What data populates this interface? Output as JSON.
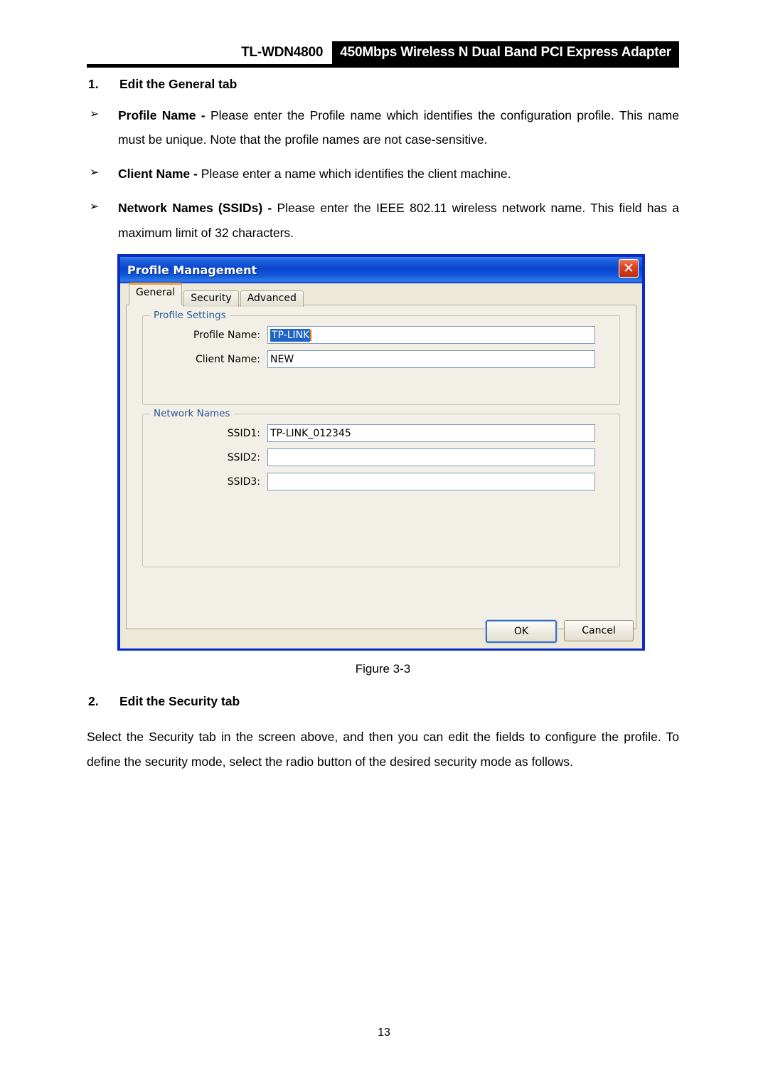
{
  "header": {
    "model": "TL-WDN4800",
    "product": "450Mbps Wireless N Dual Band PCI Express Adapter"
  },
  "sections": [
    {
      "number": "1.",
      "title": "Edit the General tab"
    },
    {
      "number": "2.",
      "title": "Edit the Security tab"
    }
  ],
  "bullets": [
    {
      "marker": "➢",
      "term": "Profile Name",
      "dash": " - ",
      "description": "Please enter the Profile name which identifies the configuration profile. This name must be unique. Note that the profile names are not case-sensitive."
    },
    {
      "marker": "➢",
      "term": "Client Name",
      "dash": " - ",
      "description": "Please enter a name which identifies the client machine."
    },
    {
      "marker": "➢",
      "term": "Network Names (SSIDs)",
      "dash": " - ",
      "description": "Please enter the IEEE 802.11 wireless network name. This field has a maximum limit of 32 characters."
    }
  ],
  "figure": {
    "caption": "Figure 3-3"
  },
  "security_paragraph": "Select the Security tab in the screen above, and then you can edit the fields to configure the profile. To define the security mode, select the radio button of the desired security mode as follows.",
  "page_number": "13",
  "dialog": {
    "title": "Profile Management",
    "close_label": "✕",
    "tabs": [
      {
        "label": "General",
        "active": true
      },
      {
        "label": "Security",
        "active": false
      },
      {
        "label": "Advanced",
        "active": false
      }
    ],
    "groups": {
      "profile_settings": {
        "legend": "Profile Settings",
        "fields": [
          {
            "label": "Profile Name:",
            "value": "TP-LINK",
            "selected": true,
            "placeholder": ""
          },
          {
            "label": "Client Name:",
            "value": "NEW",
            "selected": false,
            "placeholder": ""
          }
        ]
      },
      "network_names": {
        "legend": "Network Names",
        "fields": [
          {
            "label": "SSID1:",
            "value": "TP-LINK_012345",
            "selected": false,
            "placeholder": ""
          },
          {
            "label": "SSID2:",
            "value": "",
            "selected": false,
            "placeholder": ""
          },
          {
            "label": "SSID3:",
            "value": "",
            "selected": false,
            "placeholder": ""
          }
        ]
      }
    },
    "buttons": {
      "ok": "OK",
      "cancel": "Cancel"
    }
  },
  "colors": {
    "titlebar_blue": "#0a45cf",
    "dialog_border": "#0a2bc4",
    "face": "#ece9d8",
    "panel": "#f2f0e6",
    "legend_text": "#2b5797",
    "active_tab_accent": "#f2a03c",
    "selection_blue": "#1f62c8",
    "close_red": "#c02d10"
  }
}
